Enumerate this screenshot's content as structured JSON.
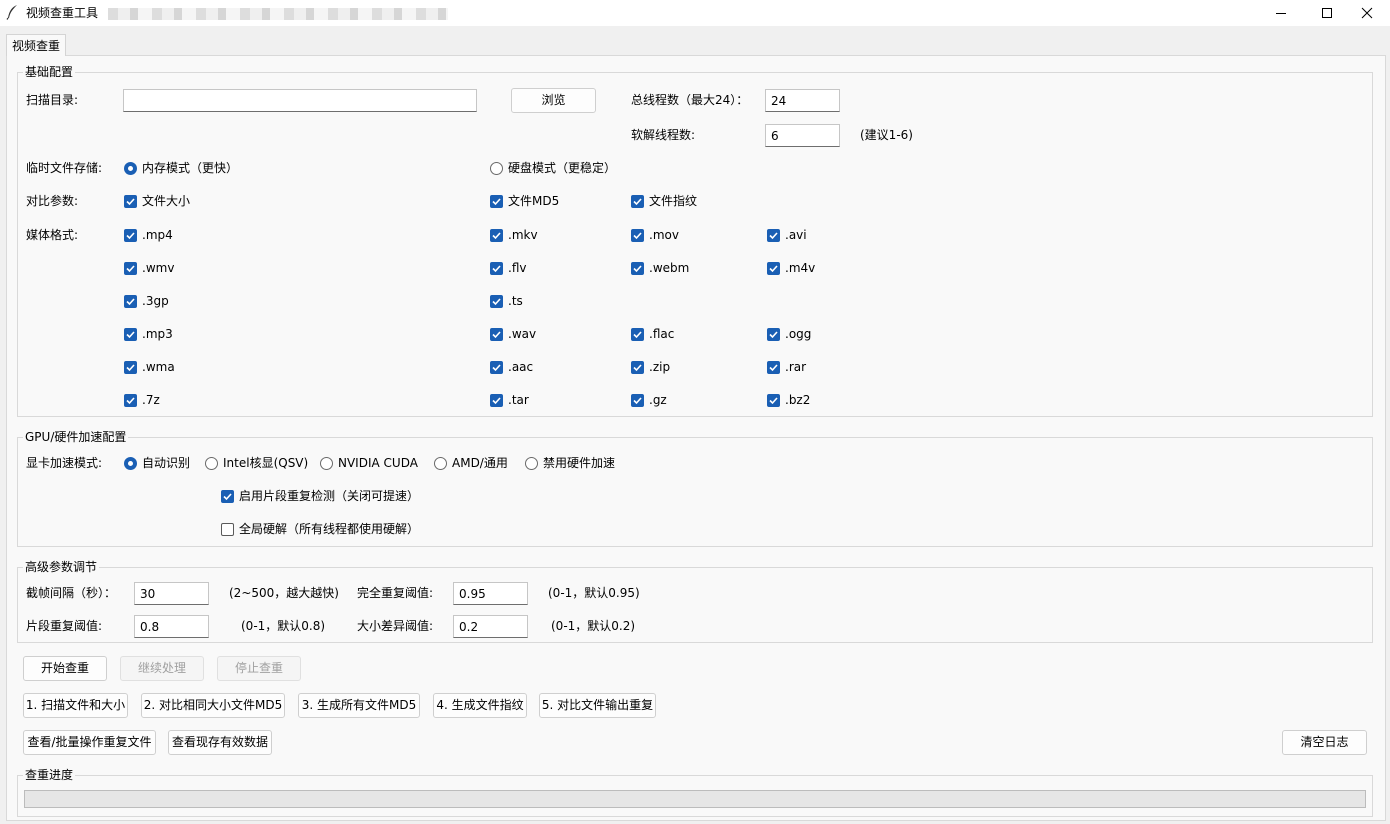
{
  "window": {
    "title": "视频查重工具"
  },
  "tab": {
    "label": "视频查重"
  },
  "basic": {
    "title": "基础配置",
    "scan_dir_label": "扫描目录:",
    "scan_dir_value": "",
    "browse_label": "浏览",
    "total_threads_label": "总线程数（最大24）：",
    "total_threads_value": "24",
    "soft_threads_label": "软解线程数:",
    "soft_threads_value": "6",
    "soft_threads_hint": "(建议1-6)",
    "temp_label": "临时文件存储:",
    "temp_options": [
      {
        "label": "内存模式（更快）",
        "selected": true
      },
      {
        "label": "硬盘模式（更稳定）",
        "selected": false
      }
    ],
    "compare_label": "对比参数:",
    "compare_options": [
      {
        "label": "文件大小",
        "checked": true
      },
      {
        "label": "文件MD5",
        "checked": true
      },
      {
        "label": "文件指纹",
        "checked": true
      }
    ],
    "media_label": "媒体格式:",
    "media_rows": [
      [
        {
          "label": ".mp4",
          "checked": true
        },
        {
          "label": ".mkv",
          "checked": true
        },
        {
          "label": ".mov",
          "checked": true
        },
        {
          "label": ".avi",
          "checked": true
        }
      ],
      [
        {
          "label": ".wmv",
          "checked": true
        },
        {
          "label": ".flv",
          "checked": true
        },
        {
          "label": ".webm",
          "checked": true
        },
        {
          "label": ".m4v",
          "checked": true
        }
      ],
      [
        {
          "label": ".3gp",
          "checked": true
        },
        {
          "label": ".ts",
          "checked": true
        }
      ],
      [
        {
          "label": ".mp3",
          "checked": true
        },
        {
          "label": ".wav",
          "checked": true
        },
        {
          "label": ".flac",
          "checked": true
        },
        {
          "label": ".ogg",
          "checked": true
        }
      ],
      [
        {
          "label": ".wma",
          "checked": true
        },
        {
          "label": ".aac",
          "checked": true
        },
        {
          "label": ".zip",
          "checked": true
        },
        {
          "label": ".rar",
          "checked": true
        }
      ],
      [
        {
          "label": ".7z",
          "checked": true
        },
        {
          "label": ".tar",
          "checked": true
        },
        {
          "label": ".gz",
          "checked": true
        },
        {
          "label": ".bz2",
          "checked": true
        }
      ]
    ]
  },
  "gpu": {
    "title": "GPU/硬件加速配置",
    "mode_label": "显卡加速模式:",
    "modes": [
      {
        "label": "自动识别",
        "selected": true
      },
      {
        "label": "Intel核显(QSV)",
        "selected": false
      },
      {
        "label": "NVIDIA CUDA",
        "selected": false
      },
      {
        "label": "AMD/通用",
        "selected": false
      },
      {
        "label": "禁用硬件加速",
        "selected": false
      }
    ],
    "segment_check": {
      "label": "启用片段重复检测（关闭可提速）",
      "checked": true
    },
    "global_hw": {
      "label": "全局硬解（所有线程都使用硬解）",
      "checked": false
    }
  },
  "advanced": {
    "title": "高级参数调节",
    "frame_interval_label": "截帧间隔（秒）：",
    "frame_interval_value": "30",
    "frame_interval_hint": "(2~500，越大越快)",
    "full_dup_label": "完全重复阈值:",
    "full_dup_value": "0.95",
    "full_dup_hint": "(0-1，默认0.95)",
    "segment_dup_label": "片段重复阈值:",
    "segment_dup_value": "0.8",
    "segment_dup_hint": "(0-1，默认0.8)",
    "size_diff_label": "大小差异阈值:",
    "size_diff_value": "0.2",
    "size_diff_hint": "(0-1，默认0.2)"
  },
  "actions": {
    "start": "开始查重",
    "resume": "继续处理",
    "stop": "停止查重",
    "step1": "1. 扫描文件和大小",
    "step2": "2. 对比相同大小文件MD5",
    "step3": "3. 生成所有文件MD5",
    "step4": "4. 生成文件指纹",
    "step5": "5. 对比文件输出重复",
    "view_dup": "查看/批量操作重复文件",
    "view_valid": "查看现存有效数据",
    "clear_log": "清空日志"
  },
  "progress": {
    "title": "查重进度",
    "percent": 0
  },
  "colors": {
    "accent": "#1a5fb4",
    "window_bg": "#f0f0f0",
    "pane_bg": "#f9f9f9"
  }
}
